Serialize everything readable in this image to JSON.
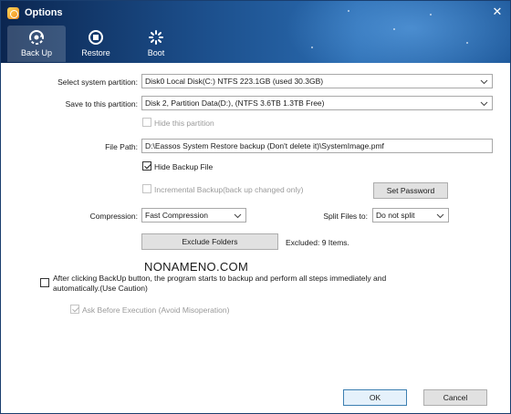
{
  "window": {
    "title": "Options",
    "close_glyph": "✕"
  },
  "tabs": [
    {
      "label": "Back Up",
      "icon": "backup-icon",
      "active": true
    },
    {
      "label": "Restore",
      "icon": "restore-icon",
      "active": false
    },
    {
      "label": "Boot",
      "icon": "boot-icon",
      "active": false
    }
  ],
  "form": {
    "system_partition": {
      "label": "Select system partition:",
      "value": "Disk0  Local Disk(C:) NTFS 223.1GB (used 30.3GB)"
    },
    "save_partition": {
      "label": "Save to this partition:",
      "value": "Disk 2, Partition Data(D:), (NTFS 3.6TB 1.3TB Free)"
    },
    "hide_partition": {
      "label": "Hide this partition",
      "checked": false,
      "disabled": true
    },
    "file_path": {
      "label": "File Path:",
      "value": "D:\\Eassos System Restore backup (Don't delete it)\\SystemImage.pmf"
    },
    "hide_backup_file": {
      "label": "Hide Backup File",
      "checked": true
    },
    "incremental_backup": {
      "label": "Incremental Backup(back up changed only)",
      "checked": false,
      "disabled": true
    },
    "set_password_label": "Set Password",
    "compression": {
      "label": "Compression:",
      "value": "Fast Compression"
    },
    "split_files": {
      "label": "Split Files to:",
      "value": "Do not split"
    },
    "exclude_folders_label": "Exclude Folders",
    "excluded_text": "Excluded: 9 Items.",
    "watermark": "NONAMENO.COM",
    "auto_backup": {
      "label_line1": "After clicking BackUp button, the program starts to backup and perform all steps immediately and",
      "label_line2": "automatically.(Use Caution)",
      "checked": false
    },
    "ask_before": {
      "label": "Ask Before Execution (Avoid Misoperation)",
      "checked": true,
      "disabled": true
    }
  },
  "buttons": {
    "ok": "OK",
    "cancel": "Cancel"
  }
}
